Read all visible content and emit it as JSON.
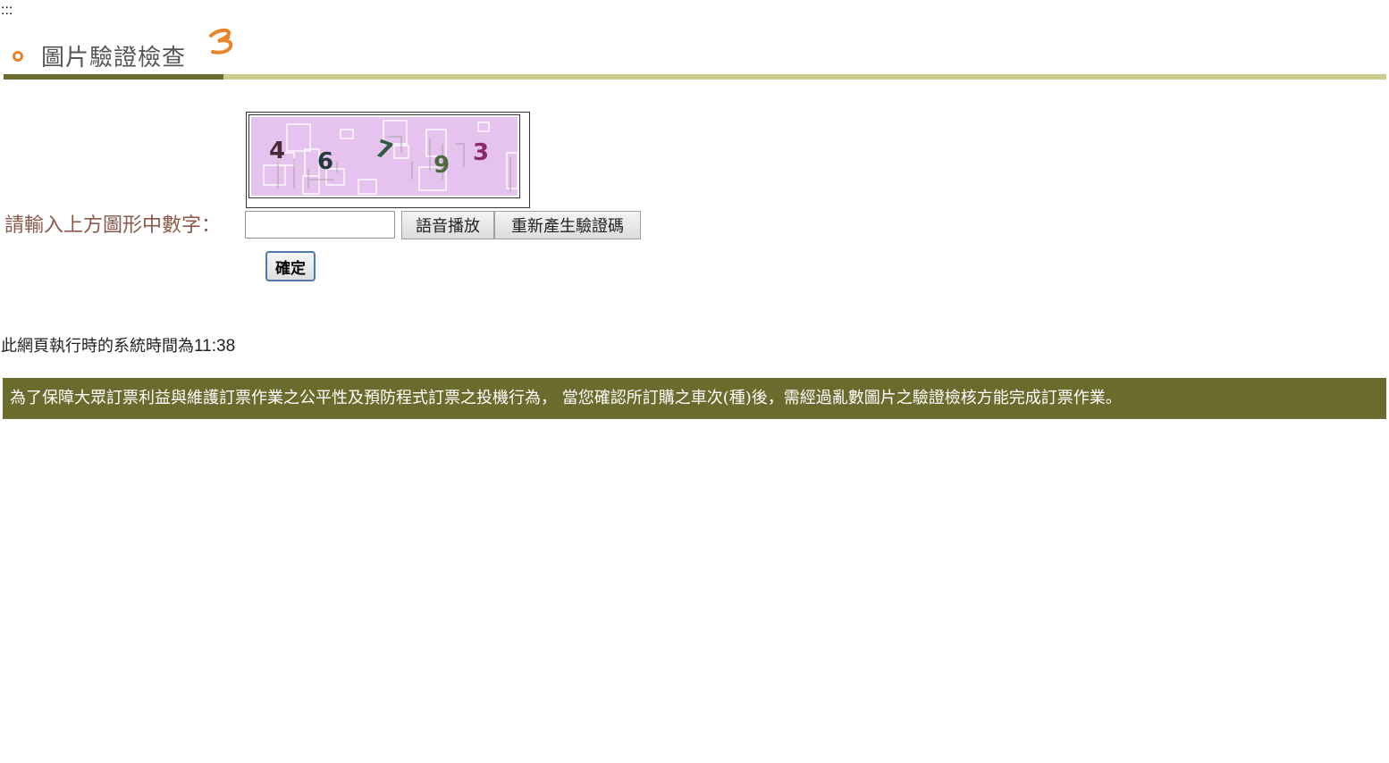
{
  "accesskey": ":::",
  "header": {
    "title": "圖片驗證檢查",
    "colors": {
      "accent_orange": "#e8852a",
      "bar_dark": "#6b6b2e",
      "bar_light": "#cccc8c"
    }
  },
  "captcha": {
    "digits": "4 6 7 9 3",
    "background_color": "#e6c3ee"
  },
  "form": {
    "prompt_label": "請輸入上方圖形中數字：",
    "input_value": "",
    "audio_button": "語音播放",
    "regenerate_button": "重新產生驗證碼",
    "confirm_button": "確定"
  },
  "system_time": {
    "label": "此網頁執行時的系統時間為",
    "time": "11:38"
  },
  "notice": {
    "text": "為了保障大眾訂票利益與維護訂票作業之公平性及預防程式訂票之投機行為， 當您確認所訂購之車次(種)後，需經過亂數圖片之驗證檢核方能完成訂票作業。",
    "background": "#6b6b2e"
  }
}
